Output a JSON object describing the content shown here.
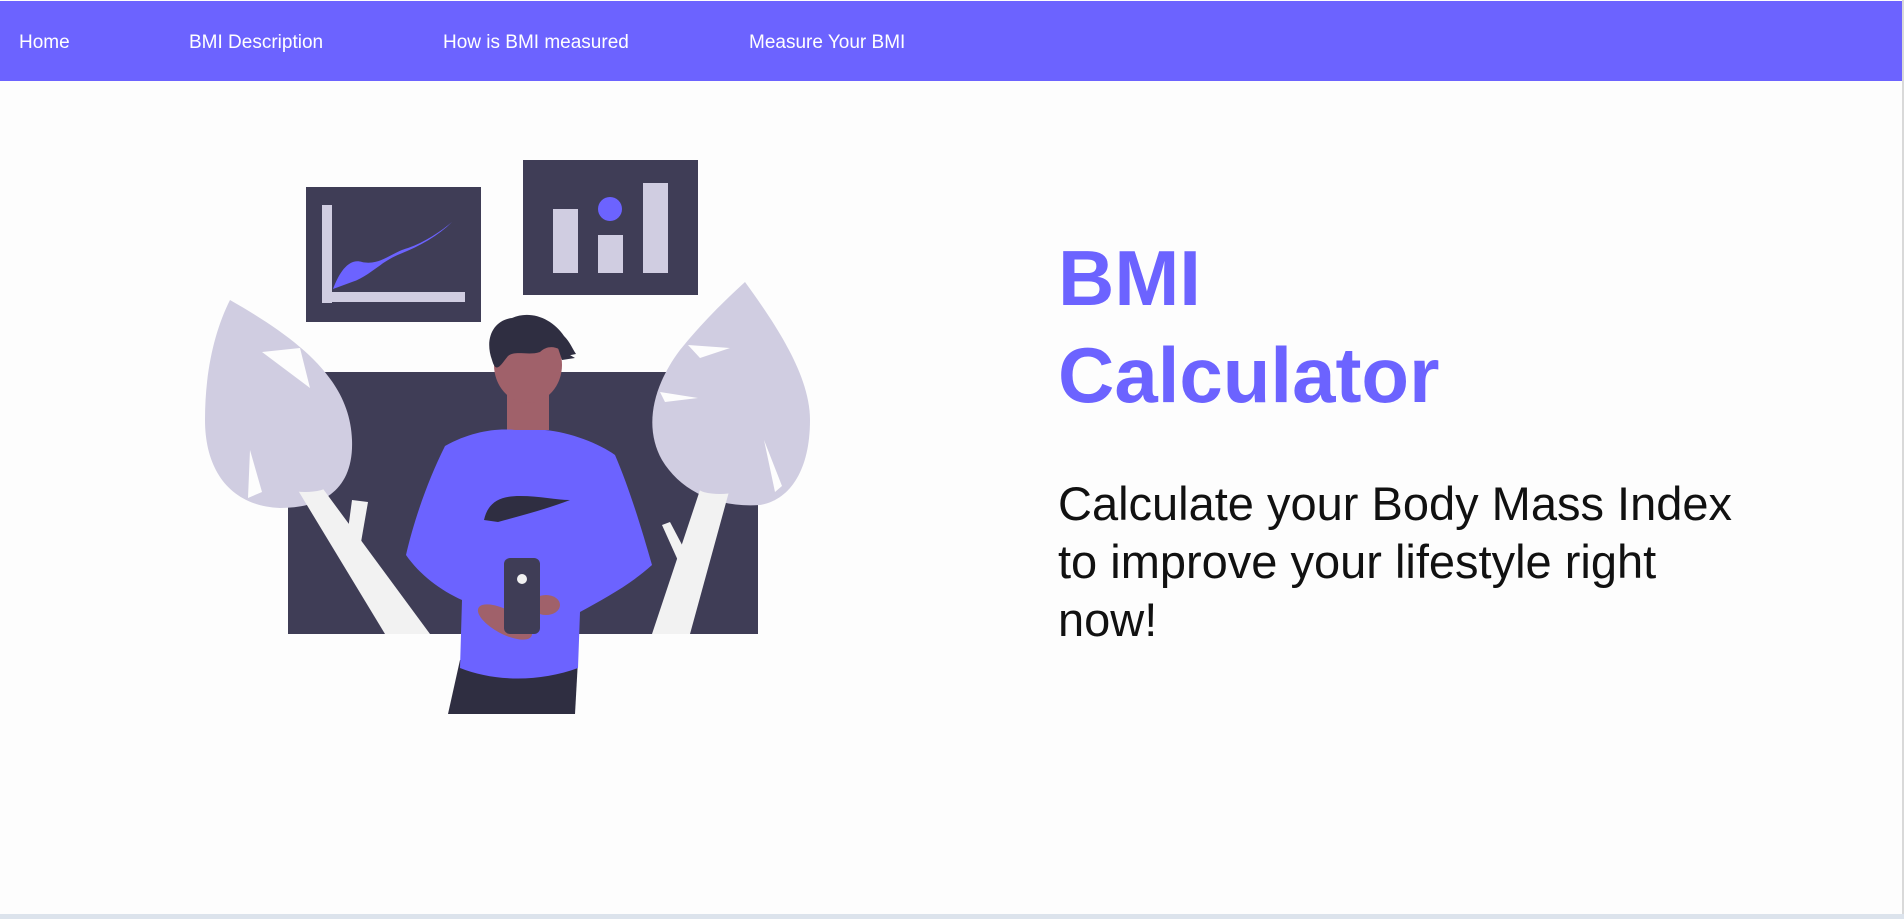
{
  "nav": {
    "items": [
      {
        "label": "Home"
      },
      {
        "label": "BMI Description"
      },
      {
        "label": "How is BMI measured"
      },
      {
        "label": "Measure Your BMI"
      }
    ]
  },
  "hero": {
    "title_line1": "BMI",
    "title_line2": "Calculator",
    "subtitle": "Calculate your Body Mass Index to improve your lifestyle right now!",
    "illustration_icon": "person-with-phone-and-charts-illustration"
  },
  "colors": {
    "accent": "#6c63ff",
    "dark": "#3f3d56",
    "light": "#d0cde1",
    "skin": "#a0616a",
    "white": "#f2f2f2"
  }
}
